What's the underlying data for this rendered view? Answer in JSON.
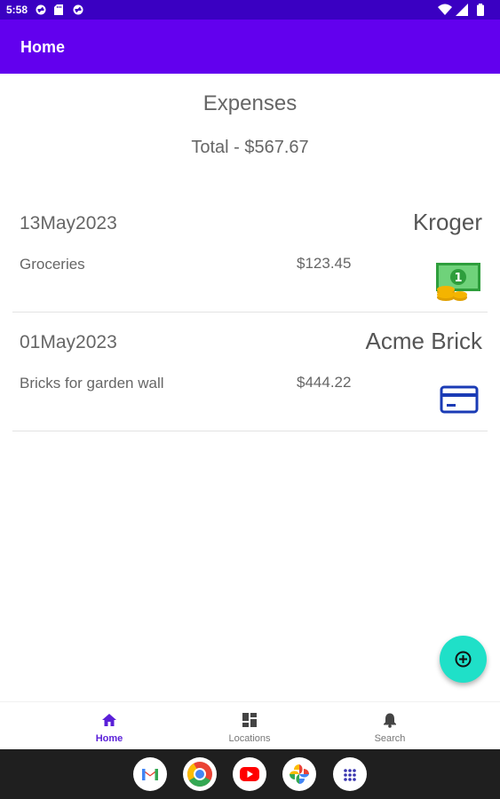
{
  "status_bar": {
    "time": "5:58",
    "left_icons": [
      "vpn-icon",
      "sd-card-icon",
      "vpn-icon"
    ],
    "right_icons": [
      "wifi-icon",
      "signal-icon",
      "battery-icon"
    ]
  },
  "app_bar": {
    "title": "Home"
  },
  "header": {
    "title": "Expenses",
    "total": "Total - $567.67"
  },
  "expenses": [
    {
      "date": "13May2023",
      "vendor": "Kroger",
      "description": "Groceries",
      "amount": "$123.45",
      "payment_icon": "cash-icon"
    },
    {
      "date": "01May2023",
      "vendor": "Acme Brick",
      "description": "Bricks for garden wall",
      "amount": "$444.22",
      "payment_icon": "credit-card-icon"
    }
  ],
  "fab": {
    "icon": "add-circle-icon",
    "color": "#1fe0c8"
  },
  "bottom_nav": [
    {
      "label": "Home",
      "icon": "home-icon",
      "active": true
    },
    {
      "label": "Locations",
      "icon": "dashboard-icon",
      "active": false
    },
    {
      "label": "Search",
      "icon": "bell-icon",
      "active": false
    }
  ],
  "dock_apps": [
    "gmail-icon",
    "chrome-icon",
    "youtube-icon",
    "photos-icon",
    "app-drawer-icon"
  ],
  "colors": {
    "status_bar": "#3a00c2",
    "app_bar": "#6200ee",
    "accent": "#5a1fd8",
    "card_icon": "#1a3bb5",
    "cash_icon": "#3cb54a",
    "coin": "#f4b400"
  }
}
